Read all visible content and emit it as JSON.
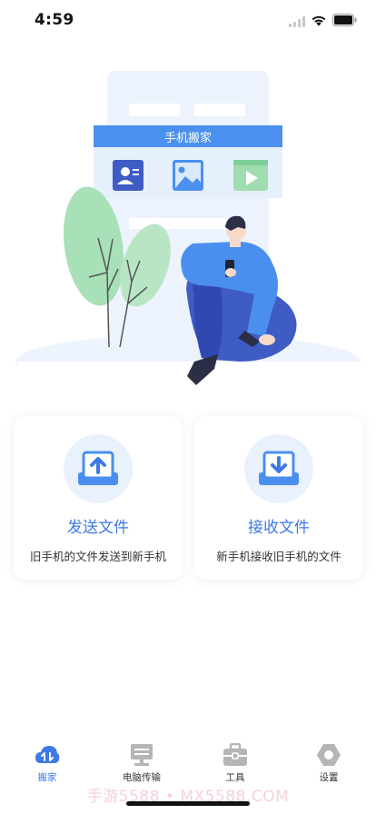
{
  "status_bar": {
    "time": "4:59",
    "icons": [
      "signal-icon",
      "wifi-icon",
      "battery-icon"
    ]
  },
  "hero": {
    "banner_title": "手机搬家",
    "icons": [
      "contacts-icon",
      "photos-icon",
      "video-icon"
    ]
  },
  "actions": [
    {
      "title": "发送文件",
      "subtitle": "旧手机的文件发送到新手机",
      "icon": "upload-icon"
    },
    {
      "title": "接收文件",
      "subtitle": "新手机接收旧手机的文件",
      "icon": "download-icon"
    }
  ],
  "tabs": [
    {
      "label": "搬家",
      "icon": "cloud-transfer-icon",
      "active": true
    },
    {
      "label": "电脑传输",
      "icon": "computer-icon",
      "active": false
    },
    {
      "label": "工具",
      "icon": "toolbox-icon",
      "active": false
    },
    {
      "label": "设置",
      "icon": "hex-gear-icon",
      "active": false
    }
  ],
  "watermark": "手游5588 • MX5588.COM",
  "colors": {
    "accent": "#3d7ae6",
    "banner": "#4a90ee",
    "leaf": "#9fdcb0",
    "shirt": "#4a8fee",
    "pants": "#3f5bc4"
  }
}
